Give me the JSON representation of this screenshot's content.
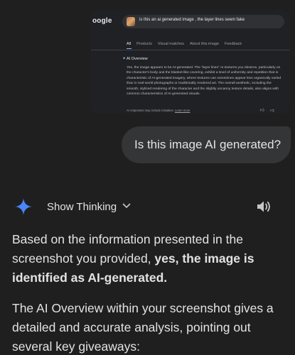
{
  "screenshot": {
    "logo_text": "oogle",
    "search_query": "is this an ai generated image , the layer lines seem fake",
    "tabs": [
      {
        "label": "All",
        "active": true
      },
      {
        "label": "Products",
        "active": false
      },
      {
        "label": "Visual matches",
        "active": false
      },
      {
        "label": "About this image",
        "active": false
      },
      {
        "label": "Feedback",
        "active": false
      }
    ],
    "ai_overview": {
      "title": "AI Overview",
      "body": "Yes, the image appears to be AI-generated. The \"layer lines\" or textures you observe, particularly on the character's body and the blanket-like covering, exhibit a level of uniformity and repetition that is characteristic of AI-generated imagery, where textures can sometimes appear less organically varied than in real-world photographs or traditionally rendered art. The overall aesthetic, including the smooth, stylized rendering of the character and the slightly uncanny texture details, also aligns with common characteristics of AI-generated visuals.",
      "disclaimer": "AI responses may include mistakes.",
      "learn_more": "Learn more"
    }
  },
  "user_message": "Is this image AI generated?",
  "thinking": {
    "label": "Show Thinking"
  },
  "response": {
    "p1_start": "Based on the information presented in the screenshot you provided, ",
    "p1_bold": "yes, the image is identified as AI-generated.",
    "p2": "The AI Overview within your screenshot gives a detailed and accurate analysis, pointing out several key giveaways:"
  },
  "colors": {
    "background": "#1f1f20",
    "bubble": "#333537",
    "sparkle": "#4a86f7",
    "text": "#e3e3e3"
  }
}
